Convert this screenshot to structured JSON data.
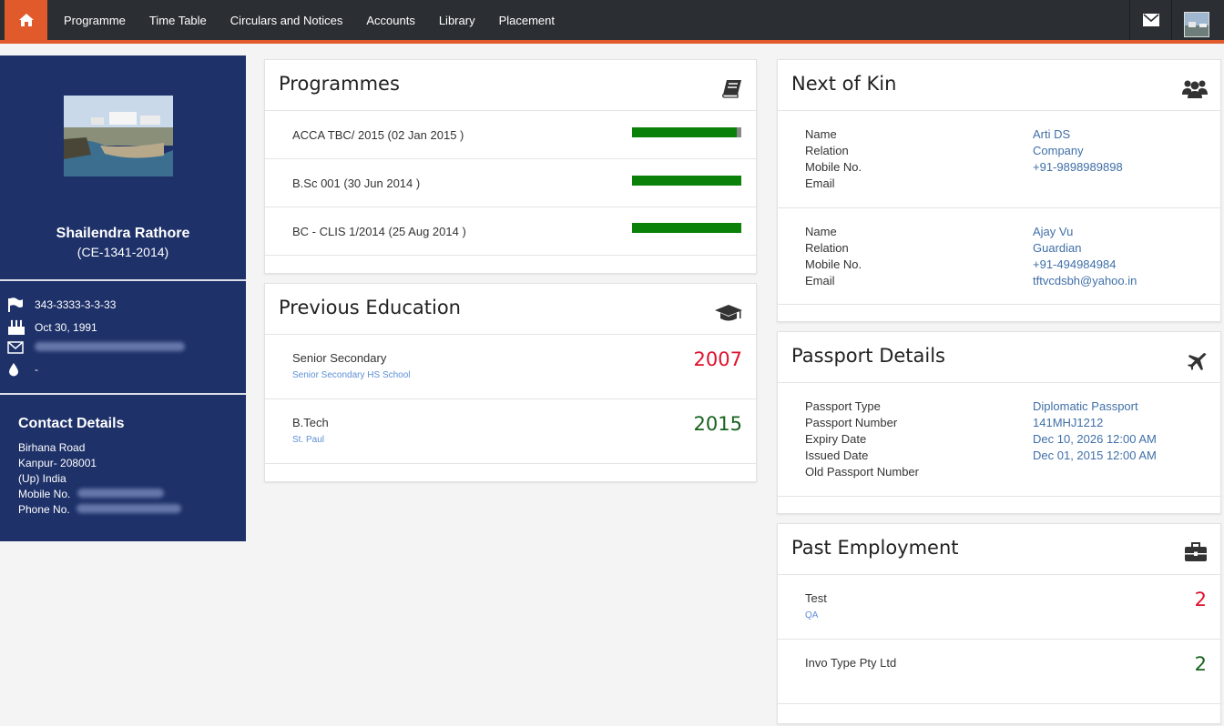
{
  "nav": {
    "items": [
      "Programme",
      "Time Table",
      "Circulars and Notices",
      "Accounts",
      "Library",
      "Placement"
    ]
  },
  "profile": {
    "name": "Shailendra Rathore",
    "id": "(CE-1341-2014)",
    "phone": "343-3333-3-3-33",
    "dob": "Oct 30, 1991",
    "blood_group": "-"
  },
  "contact": {
    "title": "Contact Details",
    "address_line1": "Birhana Road",
    "address_line2": "Kanpur- 208001",
    "address_line3": "(Up) India",
    "mobile_label": "Mobile No.",
    "phone_label": "Phone No."
  },
  "programmes": {
    "title": "Programmes",
    "items": [
      {
        "label": "ACCA TBC/ 2015 (02 Jan 2015 )",
        "progress": 0.96
      },
      {
        "label": "B.Sc 001 (30 Jun 2014 )",
        "progress": 1.0
      },
      {
        "label": "BC - CLIS 1/2014 (25 Aug 2014 )",
        "progress": 1.0
      }
    ]
  },
  "education": {
    "title": "Previous Education",
    "items": [
      {
        "title": "Senior Secondary",
        "school": "Senior Secondary HS School",
        "year": "2007"
      },
      {
        "title": "B.Tech",
        "school": "St. Paul",
        "year": "2015"
      }
    ]
  },
  "kin": {
    "title": "Next of Kin",
    "labels": {
      "name": "Name",
      "relation": "Relation",
      "mobile": "Mobile No.",
      "email": "Email"
    },
    "items": [
      {
        "name": "Arti DS",
        "relation": "Company",
        "mobile": "+91-9898989898",
        "email": ""
      },
      {
        "name": "Ajay Vu",
        "relation": "Guardian",
        "mobile": "+91-494984984",
        "email": "tftvcdsbh@yahoo.in"
      }
    ]
  },
  "passport": {
    "title": "Passport Details",
    "labels": {
      "type": "Passport Type",
      "number": "Passport Number",
      "expiry": "Expiry Date",
      "issued": "Issued Date",
      "old": "Old Passport Number"
    },
    "type": "Diplomatic Passport",
    "number": "141MHJ1212",
    "expiry": "Dec 10, 2026 12:00 AM",
    "issued": "Dec 01, 2015 12:00 AM",
    "old": ""
  },
  "employment": {
    "title": "Past Employment",
    "items": [
      {
        "company": "Test",
        "role": "QA",
        "years": "2"
      },
      {
        "company": "Invo Type Pty Ltd",
        "role": "",
        "years": "2"
      }
    ]
  },
  "colors": {
    "navbar": "#2b2f33",
    "accent": "#e05a2b",
    "sidebar": "#1e3169",
    "progress": "#0a820a",
    "value_link": "#3f6fa8",
    "year_red": "#e0102c",
    "year_green": "#16631e"
  }
}
